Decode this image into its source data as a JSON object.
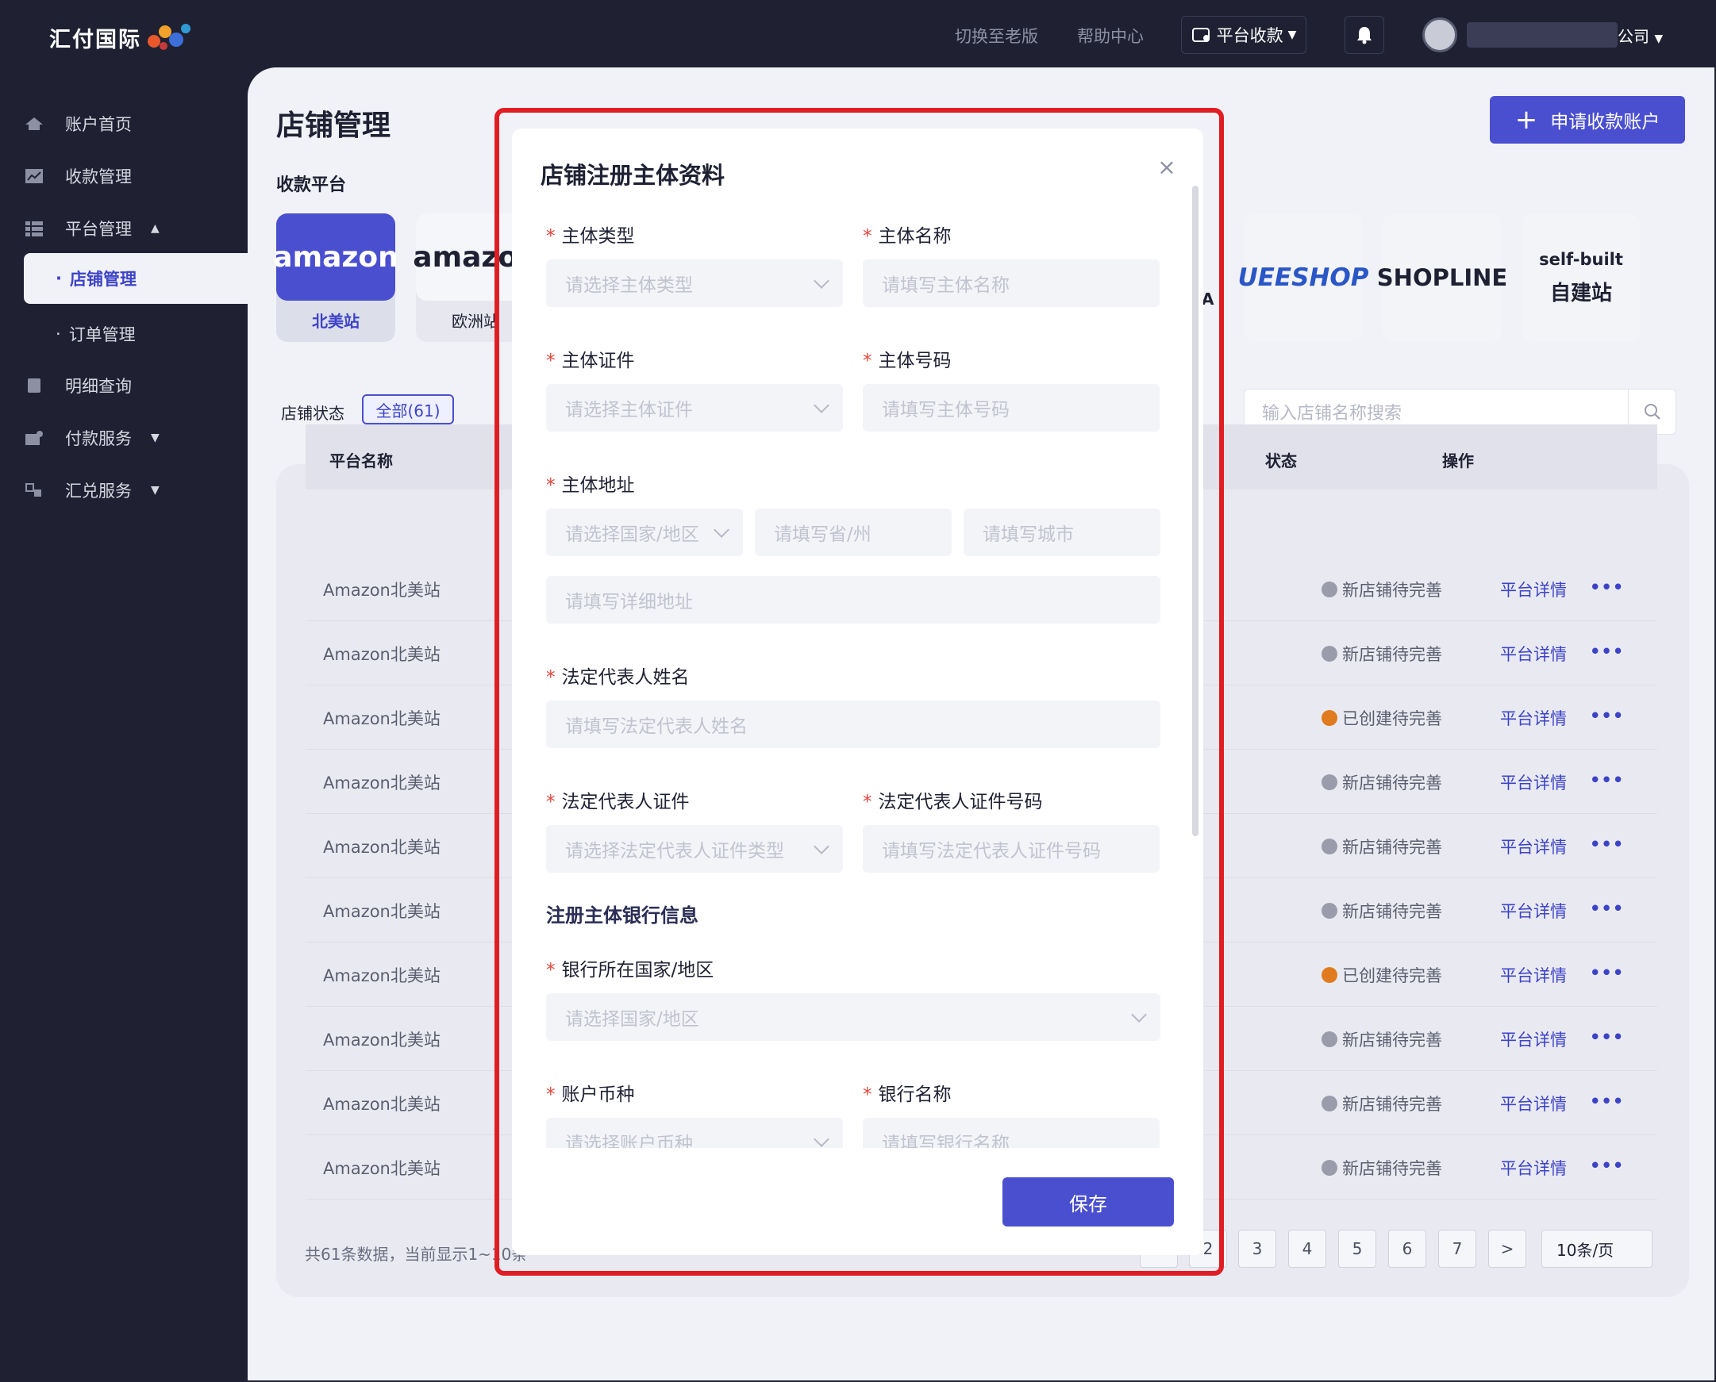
{
  "header": {
    "logo_text": "汇付国际",
    "switch_old": "切换至老版",
    "help_center": "帮助中心",
    "platform_collect": "平台收款",
    "company_suffix": "公司"
  },
  "sidebar": {
    "items": [
      {
        "label": "账户首页",
        "icon": "home-icon"
      },
      {
        "label": "收款管理",
        "icon": "chart-icon"
      },
      {
        "label": "平台管理",
        "icon": "list-icon"
      },
      {
        "label": "店铺管理",
        "icon": ""
      },
      {
        "label": "订单管理",
        "icon": ""
      },
      {
        "label": "明细查询",
        "icon": "doc-icon"
      },
      {
        "label": "付款服务",
        "icon": "pay-icon"
      },
      {
        "label": "汇兑服务",
        "icon": "exchange-icon"
      }
    ]
  },
  "page": {
    "title": "店铺管理",
    "apply_button": "申请收款账户",
    "section_platform": "收款平台",
    "platforms": [
      {
        "logo": "amazon",
        "label": "北美站"
      },
      {
        "logo": "amazon",
        "label": "欧洲站"
      },
      {
        "logo": "UEESHOP",
        "label": ""
      },
      {
        "logo": "SHOPLINE",
        "label": ""
      },
      {
        "logo_line1": "self-built",
        "logo_line2": "自建站",
        "label": ""
      }
    ],
    "partial_letter": "A",
    "status_label": "店铺状态",
    "status_all": "全部(61)",
    "search_placeholder": "输入店铺名称搜索"
  },
  "table": {
    "headers": {
      "name": "平台名称",
      "status": "状态",
      "action": "操作"
    },
    "rows": [
      {
        "name": "Amazon北美站",
        "status": "新店铺待完善",
        "kind": "gray"
      },
      {
        "name": "Amazon北美站",
        "status": "新店铺待完善",
        "kind": "gray"
      },
      {
        "name": "Amazon北美站",
        "status": "已创建待完善",
        "kind": "orange"
      },
      {
        "name": "Amazon北美站",
        "status": "新店铺待完善",
        "kind": "gray"
      },
      {
        "name": "Amazon北美站",
        "status": "新店铺待完善",
        "kind": "gray"
      },
      {
        "name": "Amazon北美站",
        "status": "新店铺待完善",
        "kind": "gray"
      },
      {
        "name": "Amazon北美站",
        "status": "已创建待完善",
        "kind": "orange"
      },
      {
        "name": "Amazon北美站",
        "status": "新店铺待完善",
        "kind": "gray"
      },
      {
        "name": "Amazon北美站",
        "status": "新店铺待完善",
        "kind": "gray"
      },
      {
        "name": "Amazon北美站",
        "status": "新店铺待完善",
        "kind": "gray"
      }
    ],
    "detail_link": "平台详情",
    "more": "•••"
  },
  "pagination": {
    "summary": "共61条数据，当前显示1~10条",
    "pages": [
      "2",
      "3",
      "4",
      "5",
      "6",
      "7"
    ],
    "next": ">",
    "page_size": "10条/页"
  },
  "modal": {
    "title": "店铺注册主体资料",
    "close": "×",
    "fields": {
      "entity_type_label": "主体类型",
      "entity_type_ph": "请选择主体类型",
      "entity_name_label": "主体名称",
      "entity_name_ph": "请填写主体名称",
      "entity_cert_label": "主体证件",
      "entity_cert_ph": "请选择主体证件",
      "entity_no_label": "主体号码",
      "entity_no_ph": "请填写主体号码",
      "address_label": "主体地址",
      "country_ph": "请选择国家/地区",
      "province_ph": "请填写省/州",
      "city_ph": "请填写城市",
      "detail_address_ph": "请填写详细地址",
      "legal_name_label": "法定代表人姓名",
      "legal_name_ph": "请填写法定代表人姓名",
      "legal_cert_label": "法定代表人证件",
      "legal_cert_ph": "请选择法定代表人证件类型",
      "legal_cert_no_label": "法定代表人证件号码",
      "legal_cert_no_ph": "请填写法定代表人证件号码",
      "bank_section": "注册主体银行信息",
      "bank_country_label": "银行所在国家/地区",
      "bank_country_ph": "请选择国家/地区",
      "currency_label": "账户币种",
      "currency_ph": "请选择账户币种",
      "bank_name_label": "银行名称",
      "bank_name_ph": "请填写银行名称"
    },
    "save_button": "保存"
  },
  "colors": {
    "accent": "#4a4fd0",
    "sidebar_bg": "#1f2133",
    "content_bg": "#f1f2f7",
    "highlight": "#e11d24",
    "required": "#e3463a",
    "status_orange": "#e07b1f",
    "status_gray": "#9a9cab"
  }
}
